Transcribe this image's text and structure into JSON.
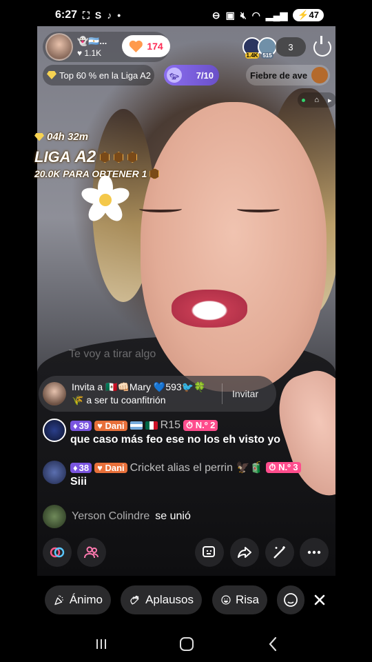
{
  "status_bar": {
    "time": "6:27",
    "left_icons": [
      "screen-record-icon",
      "s-app-icon",
      "tiktok-icon",
      "dot-icon"
    ],
    "right_icons": [
      "dnd-icon",
      "cast-icon",
      "mute-icon",
      "wifi-icon",
      "signal-icon"
    ],
    "battery": "47"
  },
  "host": {
    "name": "👻🇦🇷...",
    "likes_count": "1.1K",
    "heart_count": "174"
  },
  "viewers": {
    "top1_badge": "1.4K",
    "top2_badge": "515",
    "count": "3"
  },
  "league_pill": {
    "label": "Top 60 % en la Liga A2"
  },
  "rank_pill": {
    "progress": "7/10"
  },
  "fever_pill": {
    "label": "Fiebre de ave"
  },
  "league_overlay": {
    "timer": "04h 32m",
    "title": "LIGA",
    "tier": "A2",
    "goal": "20.0K PARA OBTENER 1"
  },
  "chat": {
    "faded_comment": "Te voy a tirar algo",
    "invite": {
      "line1": "Invita a 🇲🇽👊🏻Mary 💙593🐦🍀",
      "line2": "🌾 a ser tu coanfitrión",
      "button": "Invitar"
    },
    "comments": [
      {
        "level": "39",
        "fan": "Dani",
        "name": "R15",
        "rank": "N.º 2",
        "text": "que caso más feo ese no los eh visto yo"
      },
      {
        "level": "38",
        "fan": "Dani",
        "name": "Cricket alias el perrin 🦅🧃",
        "rank": "N.º 3",
        "text": "Siii"
      }
    ],
    "joined": {
      "name": "Yerson Colindre",
      "text": "se unió"
    }
  },
  "reactions": [
    {
      "label": "Ánimo"
    },
    {
      "label": "Aplausos"
    },
    {
      "label": "Risa"
    }
  ],
  "colors": {
    "league_purple": "#7a55e0",
    "fan_orange": "#e8703a",
    "rank_pink": "#ff4d8d",
    "heart_orange": "#ff9a4d"
  }
}
